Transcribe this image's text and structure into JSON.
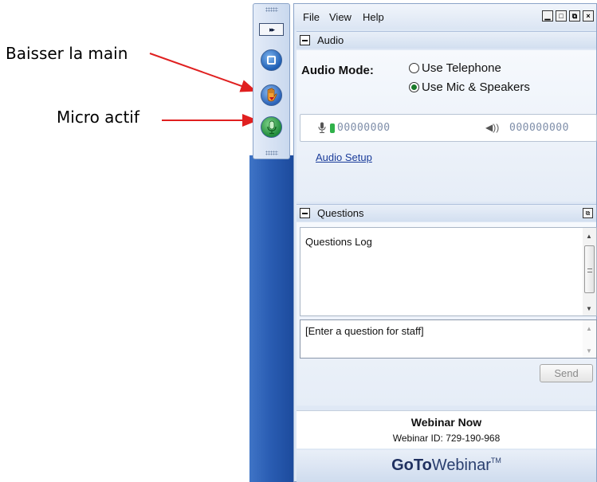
{
  "annotations": {
    "raise_hand": "Baisser la main",
    "mic_active": "Micro actif",
    "arrow_color": "#e02020"
  },
  "control_panel": {
    "collapse_glyph": "▸▸",
    "buttons": [
      "screen-icon",
      "raise-hand-icon",
      "microphone-icon"
    ]
  },
  "menu": {
    "items": [
      "File",
      "View",
      "Help"
    ],
    "window_buttons": [
      "▁",
      "□",
      "⧉",
      "×"
    ]
  },
  "audio": {
    "title": "Audio",
    "mode_label": "Audio Mode:",
    "options": [
      {
        "label": "Use Telephone",
        "checked": false
      },
      {
        "label": "Use Mic & Speakers",
        "checked": true
      }
    ],
    "mic_level": "00000000",
    "speaker_level": "000000000",
    "setup_link": "Audio Setup"
  },
  "questions": {
    "title": "Questions",
    "log_label": "Questions Log",
    "input_placeholder": "[Enter a question for staff]",
    "send_label": "Send"
  },
  "webinar": {
    "title": "Webinar Now",
    "id_text": "Webinar ID: 729-190-968"
  },
  "brand": {
    "go_to": "GoTo",
    "webinar": "Webinar",
    "tm": "TM"
  },
  "colors": {
    "desktop_blue": "#2a5db3",
    "panel_bg": "#dfe8f5",
    "mic_green": "#1f8a3a",
    "link_blue": "#1a3c9a"
  }
}
